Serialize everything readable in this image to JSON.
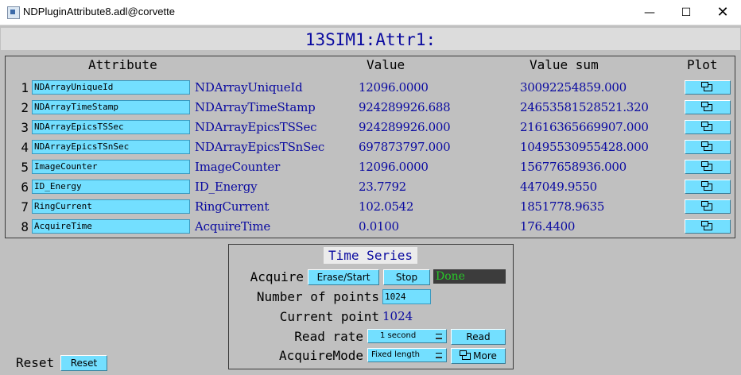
{
  "window": {
    "title": "NDPluginAttribute8.adl@corvette",
    "minimize_glyph": "—",
    "maximize_glyph": "☐",
    "close_glyph": "✕"
  },
  "page_title": "13SIM1:Attr1:",
  "columns": {
    "attribute": "Attribute",
    "value": "Value",
    "value_sum": "Value sum",
    "plot": "Plot"
  },
  "rows": [
    {
      "num": "1",
      "attribute": "NDArrayUniqueId",
      "name": "NDArrayUniqueId",
      "value": "12096.0000",
      "value_sum": "30092254859.000"
    },
    {
      "num": "2",
      "attribute": "NDArrayTimeStamp",
      "name": "NDArrayTimeStamp",
      "value": "924289926.688",
      "value_sum": "24653581528521.320"
    },
    {
      "num": "3",
      "attribute": "NDArrayEpicsTSSec",
      "name": "NDArrayEpicsTSSec",
      "value": "924289926.000",
      "value_sum": "21616365669907.000"
    },
    {
      "num": "4",
      "attribute": "NDArrayEpicsTSnSec",
      "name": "NDArrayEpicsTSnSec",
      "value": "697873797.000",
      "value_sum": "10495530955428.000"
    },
    {
      "num": "5",
      "attribute": "ImageCounter",
      "name": "ImageCounter",
      "value": "12096.0000",
      "value_sum": "15677658936.000"
    },
    {
      "num": "6",
      "attribute": "ID_Energy",
      "name": "ID_Energy",
      "value": "23.7792",
      "value_sum": "447049.9550"
    },
    {
      "num": "7",
      "attribute": "RingCurrent",
      "name": "RingCurrent",
      "value": "102.0542",
      "value_sum": "1851778.9635"
    },
    {
      "num": "8",
      "attribute": "AcquireTime",
      "name": "AcquireTime",
      "value": "0.0100",
      "value_sum": "176.4400"
    }
  ],
  "time_series": {
    "title": "Time Series",
    "acquire_label": "Acquire",
    "erase_start_label": "Erase/Start",
    "stop_label": "Stop",
    "status": "Done",
    "num_points_label": "Number of points",
    "num_points_value": "1024",
    "current_point_label": "Current point",
    "current_point_value": "1024",
    "read_rate_label": "Read rate",
    "read_rate_value": "1 second",
    "read_label": "Read",
    "acquire_mode_label": "AcquireMode",
    "acquire_mode_value": "Fixed length",
    "more_label": "More"
  },
  "reset": {
    "label": "Reset",
    "button_label": "Reset"
  },
  "colors": {
    "field_bg": "#73dfff",
    "text_blue": "#0a0aa0",
    "status_green": "#28c828",
    "status_bg": "#3c3c3c",
    "panel_bg": "#c0c0c0"
  }
}
